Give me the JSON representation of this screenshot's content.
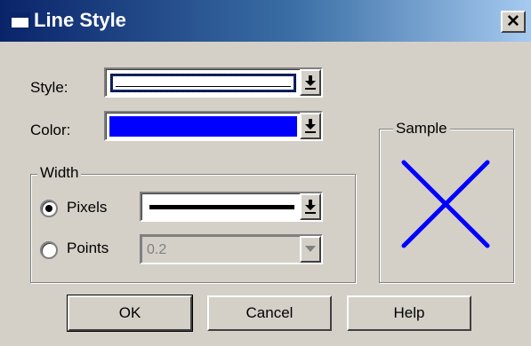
{
  "window": {
    "title": "Line Style",
    "close_label": "✕"
  },
  "style": {
    "label": "Style:",
    "value": "thin solid line"
  },
  "color": {
    "label": "Color:",
    "value": "#0000ff"
  },
  "width_group": {
    "title": "Width",
    "pixels_label": "Pixels",
    "pixels_selected": true,
    "pixels_value": "thick solid line",
    "points_label": "Points",
    "points_selected": false,
    "points_value": "0.2"
  },
  "sample": {
    "title": "Sample",
    "line_color": "#0000ff"
  },
  "buttons": {
    "ok": "OK",
    "cancel": "Cancel",
    "help": "Help"
  }
}
